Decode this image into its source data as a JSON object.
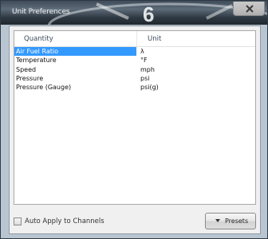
{
  "window": {
    "title": "Unit Preferences"
  },
  "table": {
    "headers": {
      "quantity": "Quantity",
      "unit": "Unit"
    },
    "rows": [
      {
        "quantity": "Air Fuel Ratio",
        "unit": "λ",
        "selected": true
      },
      {
        "quantity": "Temperature",
        "unit": "°F",
        "selected": false
      },
      {
        "quantity": "Speed",
        "unit": "mph",
        "selected": false
      },
      {
        "quantity": "Pressure",
        "unit": "psi",
        "selected": false
      },
      {
        "quantity": "Pressure (Gauge)",
        "unit": "psi(g)",
        "selected": false
      }
    ]
  },
  "footer": {
    "auto_apply_label": "Auto Apply to Channels",
    "auto_apply_checked": false,
    "presets_label": "Presets"
  },
  "icons": {
    "close": "close-icon",
    "presets_caret": "caret-down-icon"
  },
  "colors": {
    "selection": "#3399ff",
    "header_text": "#3d4a5c"
  }
}
